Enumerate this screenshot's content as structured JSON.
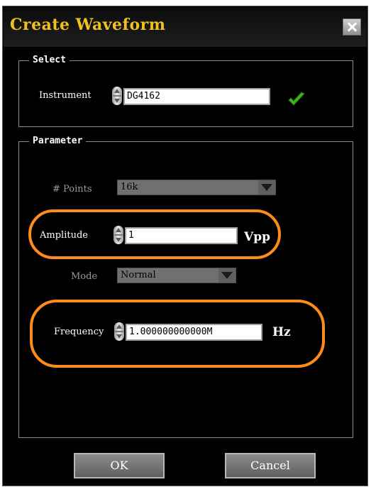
{
  "dialog": {
    "title": "Create Waveform",
    "close_icon": "close-icon"
  },
  "select_group": {
    "legend": "Select",
    "instrument_label": "Instrument",
    "instrument_value": "DG4162",
    "status_icon": "checkmark-icon",
    "status_color": "#3fb618"
  },
  "parameter_group": {
    "legend": "Parameter",
    "points_label": "# Points",
    "points_value": "16k",
    "amplitude_label": "Amplitude",
    "amplitude_value": "1",
    "amplitude_unit": "Vpp",
    "mode_label": "Mode",
    "mode_value": "Normal",
    "frequency_label": "Frequency",
    "frequency_value": "1.000000000000M",
    "frequency_unit": "Hz",
    "highlight_color": "#ff8c1a"
  },
  "footer": {
    "ok_label": "OK",
    "cancel_label": "Cancel"
  }
}
